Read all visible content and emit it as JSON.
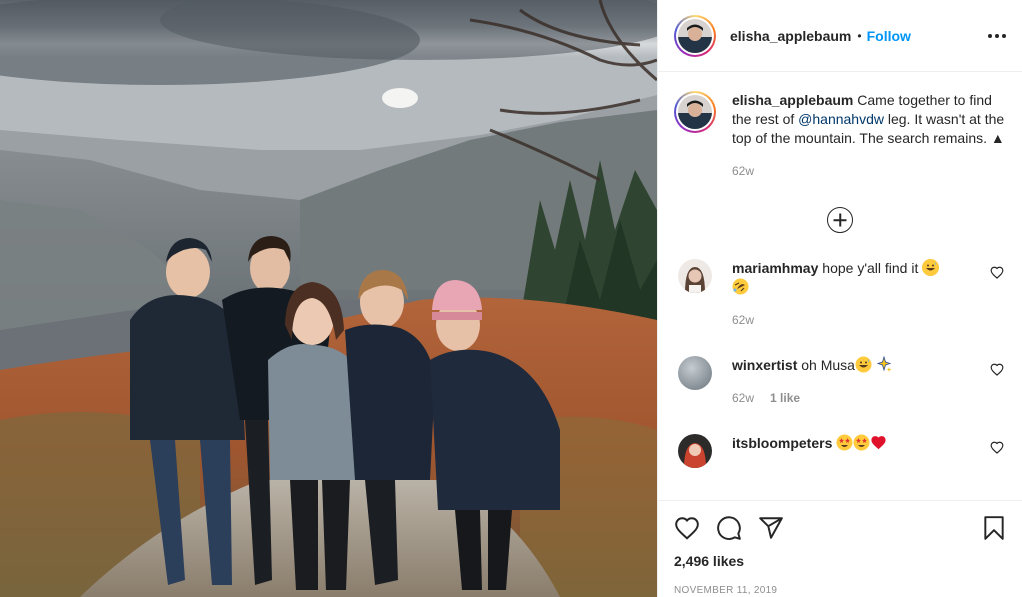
{
  "post": {
    "author": "elisha_applebaum",
    "follow_label": "Follow",
    "separator": "•",
    "caption": {
      "username": "elisha_applebaum",
      "text_before": "Came together to find the rest of",
      "mention": "@hannahvdw",
      "text_after": "leg. It wasn't at the top of the mountain. The search remains. ▲",
      "age": "62w"
    },
    "comments": [
      {
        "username": "mariamhmay",
        "text": "hope y'all find it",
        "age": "62w",
        "likes": "",
        "avatar_color": "#c9b8ae",
        "emojis": [
          "grinning-sweat",
          "rolling-laughing"
        ]
      },
      {
        "username": "winxertist",
        "text": "oh Musa",
        "age": "62w",
        "likes": "1 like",
        "avatar_color": "#9aa3aa",
        "emojis": [
          "grinning-sweat",
          "sparkles"
        ]
      },
      {
        "username": "itsbloompeters",
        "text": "",
        "age": "",
        "likes": "",
        "avatar_color": "#b33b2c",
        "emojis": [
          "star-struck",
          "star-struck",
          "red-heart"
        ]
      }
    ],
    "likes_count": "2,496 likes",
    "date": "NOVEMBER 11, 2019"
  },
  "icons": {
    "like": "heart-outline-icon",
    "comment": "speech-bubble-icon",
    "share": "paper-plane-icon",
    "save": "bookmark-icon",
    "more": "more-options-icon",
    "load_more": "plus-circle-icon"
  },
  "colors": {
    "follow": "#0095f6",
    "mention": "#00376b",
    "muted": "#8e8e8e",
    "text": "#262626"
  }
}
